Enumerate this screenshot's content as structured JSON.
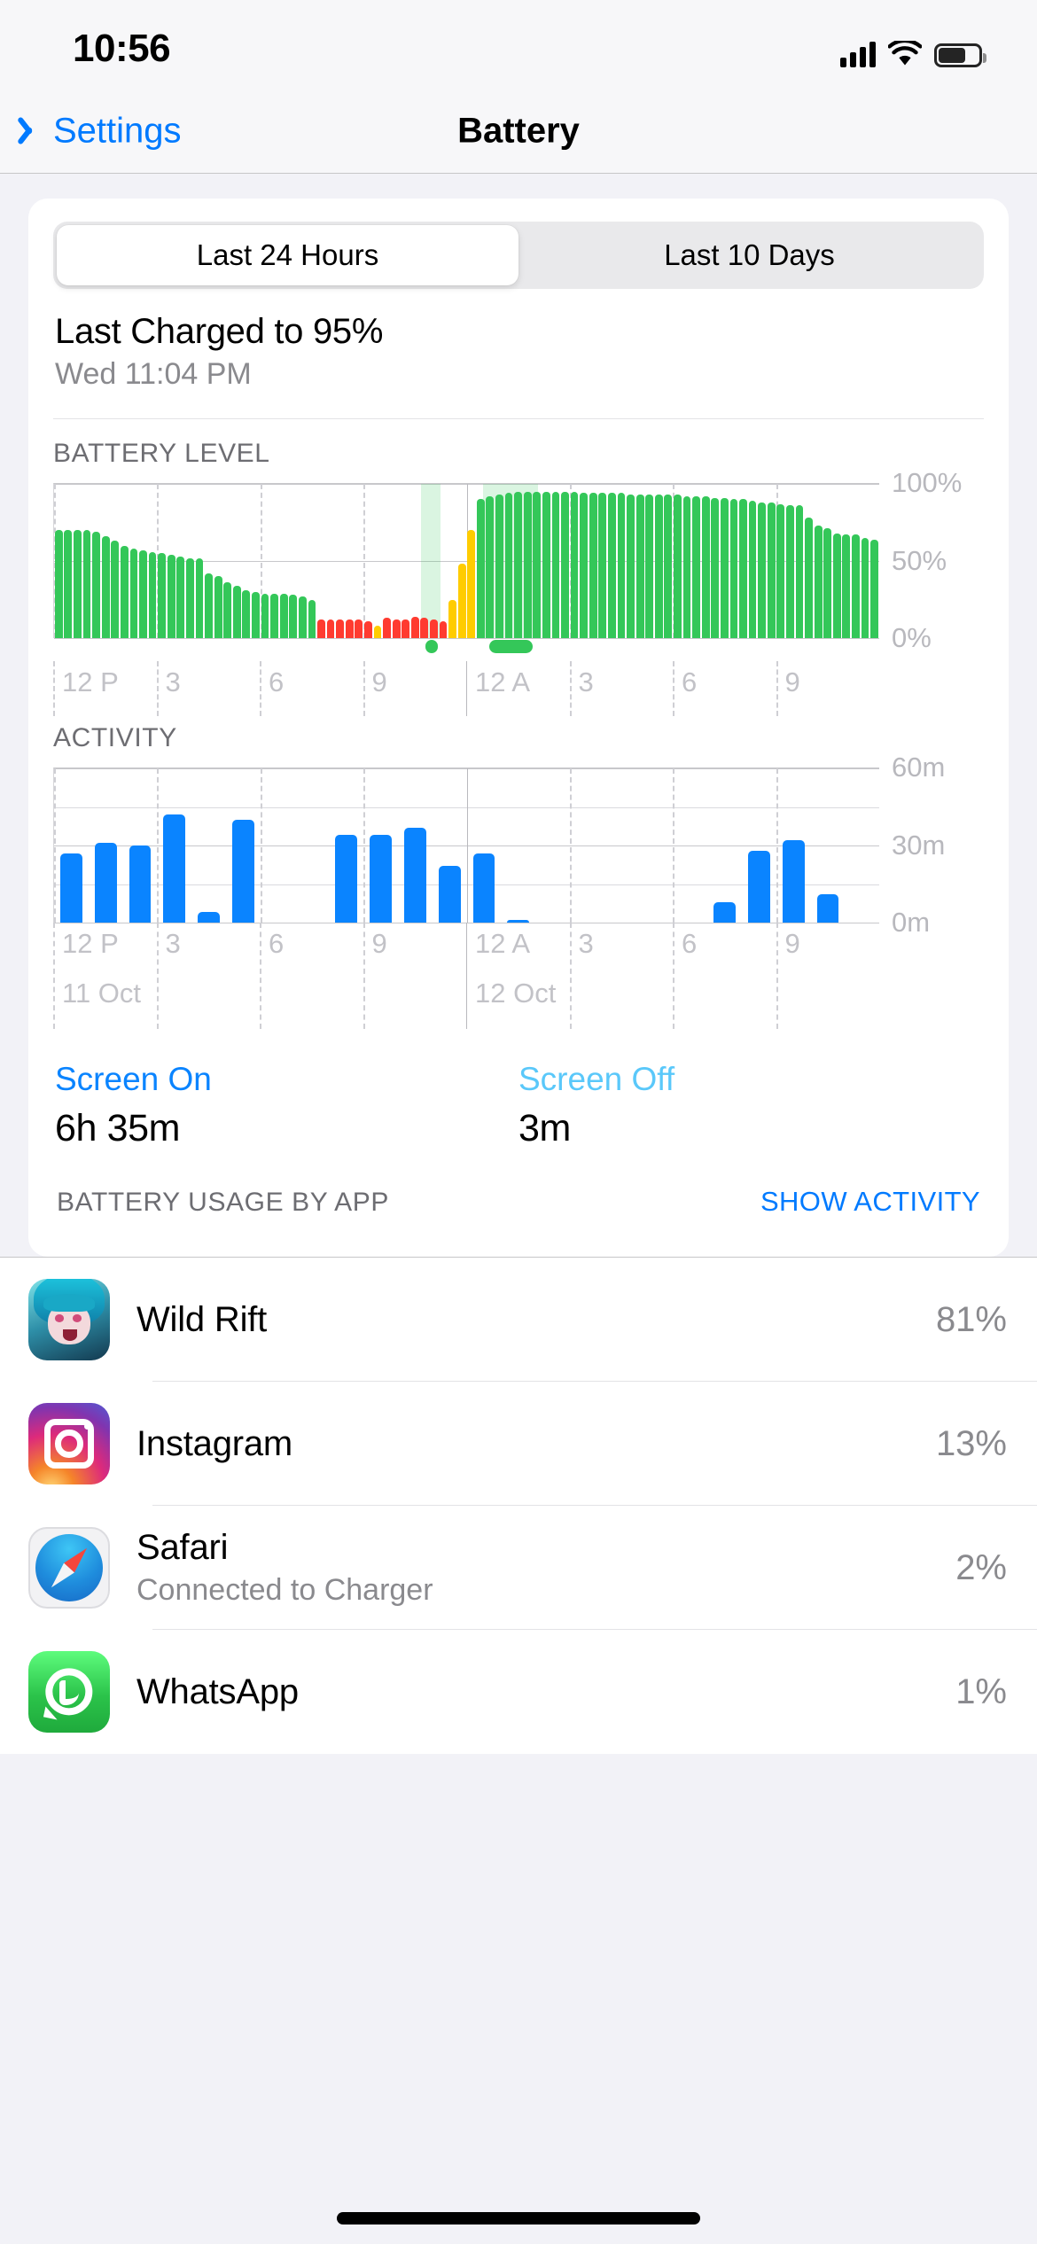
{
  "status_bar": {
    "time": "10:56",
    "cellular_icon": "cellular-bars-icon",
    "wifi_icon": "wifi-icon",
    "battery_icon": "battery-icon"
  },
  "nav": {
    "back_label": "Settings",
    "back_icon": "chevron-left-icon",
    "title": "Battery"
  },
  "segmented": {
    "options": [
      "Last 24 Hours",
      "Last 10 Days"
    ],
    "selected_index": 0
  },
  "charged": {
    "title": "Last Charged to 95%",
    "subtitle": "Wed 11:04 PM"
  },
  "screen": {
    "on_label": "Screen On",
    "on_value": "6h 35m",
    "off_label": "Screen Off",
    "off_value": "3m",
    "on_color": "#0a84ff",
    "off_color": "#5ac8fa"
  },
  "usage_header": {
    "title": "BATTERY USAGE BY APP",
    "action": "SHOW ACTIVITY",
    "action_color": "#007aff"
  },
  "apps": [
    {
      "name": "Wild Rift",
      "subtitle": "",
      "percent": "81%",
      "icon": "wild-rift-icon"
    },
    {
      "name": "Instagram",
      "subtitle": "",
      "percent": "13%",
      "icon": "instagram-icon"
    },
    {
      "name": "Safari",
      "subtitle": "Connected to Charger",
      "percent": "2%",
      "icon": "safari-icon"
    },
    {
      "name": "WhatsApp",
      "subtitle": "",
      "percent": "1%",
      "icon": "whatsapp-icon"
    }
  ],
  "chart_data": [
    {
      "type": "bar",
      "title": "BATTERY LEVEL",
      "id": "battery-level",
      "ylabel": "",
      "xlabel": "",
      "ylim": [
        0,
        100
      ],
      "ytick_labels": [
        "100%",
        "50%",
        "0%"
      ],
      "ytick_values": [
        100,
        50,
        0
      ],
      "xtick_labels": [
        "12 P",
        "3",
        "6",
        "9",
        "12 A",
        "3",
        "6",
        "9"
      ],
      "xtick_hours": [
        12,
        15,
        18,
        21,
        24,
        27,
        30,
        33
      ],
      "grid": true,
      "legend": "none",
      "colors": {
        "discharging": "#34c759",
        "low": "#ff3b30",
        "charging": "#ffcc00",
        "charge_band": "rgba(52,199,89,0.18)"
      },
      "values": [
        70,
        70,
        70,
        70,
        69,
        66,
        63,
        60,
        58,
        57,
        56,
        55,
        54,
        53,
        52,
        52,
        42,
        40,
        36,
        34,
        31,
        30,
        29,
        29,
        29,
        28,
        27,
        25,
        12,
        12,
        12,
        12,
        12,
        11,
        8,
        13,
        12,
        12,
        14,
        13,
        12,
        11,
        25,
        48,
        70,
        90,
        92,
        93,
        94,
        95,
        95,
        95,
        95,
        95,
        95,
        95,
        94,
        94,
        94,
        94,
        94,
        93,
        93,
        93,
        93,
        93,
        93,
        92,
        92,
        92,
        91,
        91,
        90,
        90,
        89,
        88,
        88,
        87,
        86,
        86,
        78,
        73,
        71,
        68,
        67,
        67,
        65,
        64
      ],
      "colors_per_bar": [
        "g",
        "g",
        "g",
        "g",
        "g",
        "g",
        "g",
        "g",
        "g",
        "g",
        "g",
        "g",
        "g",
        "g",
        "g",
        "g",
        "g",
        "g",
        "g",
        "g",
        "g",
        "g",
        "g",
        "g",
        "g",
        "g",
        "g",
        "g",
        "r",
        "r",
        "r",
        "r",
        "r",
        "r",
        "y",
        "r",
        "r",
        "r",
        "r",
        "r",
        "r",
        "r",
        "y",
        "y",
        "y",
        "g",
        "g",
        "g",
        "g",
        "g",
        "g",
        "g",
        "g",
        "g",
        "g",
        "g",
        "g",
        "g",
        "g",
        "g",
        "g",
        "g",
        "g",
        "g",
        "g",
        "g",
        "g",
        "g",
        "g",
        "g",
        "g",
        "g",
        "g",
        "g",
        "g",
        "g",
        "g",
        "g",
        "g",
        "g",
        "g",
        "g",
        "g",
        "g",
        "g",
        "g",
        "g",
        "g"
      ],
      "charge_bands": [
        {
          "start_frac": 0.445,
          "end_frac": 0.468
        },
        {
          "start_frac": 0.52,
          "end_frac": 0.586
        }
      ],
      "charge_pills": [
        {
          "start_frac": 0.451,
          "end_frac": 0.466
        },
        {
          "start_frac": 0.528,
          "end_frac": 0.58
        }
      ]
    },
    {
      "type": "bar",
      "title": "ACTIVITY",
      "id": "activity",
      "ylabel": "",
      "xlabel": "",
      "ylim": [
        0,
        60
      ],
      "ytick_labels": [
        "60m",
        "30m",
        "0m"
      ],
      "ytick_values": [
        60,
        30,
        0
      ],
      "xtick_labels": [
        "12 P",
        "3",
        "6",
        "9",
        "12 A",
        "3",
        "6",
        "9"
      ],
      "xtick_hours": [
        12,
        15,
        18,
        21,
        24,
        27,
        30,
        33
      ],
      "date_labels": [
        "11 Oct",
        "12 Oct"
      ],
      "grid": true,
      "legend": "none",
      "color": "#0a84ff",
      "categories": [
        "12P",
        "13",
        "14",
        "15",
        "16",
        "17",
        "18",
        "19",
        "20",
        "21",
        "22",
        "23",
        "0",
        "1",
        "2",
        "3",
        "4",
        "5",
        "6",
        "7",
        "8",
        "9",
        "10",
        "11"
      ],
      "values": [
        27,
        31,
        30,
        42,
        4,
        40,
        0,
        0,
        34,
        34,
        37,
        22,
        27,
        1,
        0,
        0,
        0,
        0,
        0,
        8,
        28,
        32,
        11,
        0
      ]
    }
  ]
}
